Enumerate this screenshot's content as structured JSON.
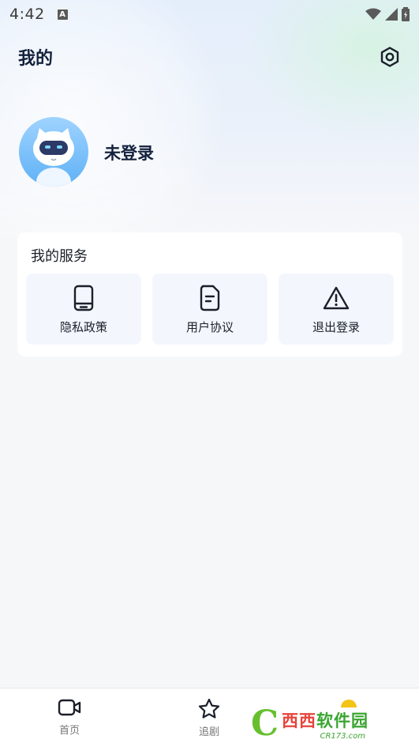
{
  "status_bar": {
    "time": "4:42",
    "notification_icon_letter": "A"
  },
  "header": {
    "title": "我的",
    "settings_icon": "hexagon-settings-icon"
  },
  "profile": {
    "avatar_icon": "robot-cat-avatar",
    "login_status": "未登录"
  },
  "services": {
    "title": "我的服务",
    "items": [
      {
        "label": "隐私政策",
        "icon": "tablet-icon"
      },
      {
        "label": "用户协议",
        "icon": "document-icon"
      },
      {
        "label": "退出登录",
        "icon": "warning-triangle-icon"
      }
    ]
  },
  "bottom_nav": {
    "items": [
      {
        "label": "首页",
        "icon": "video-icon"
      },
      {
        "label": "追剧",
        "icon": "star-icon"
      }
    ]
  },
  "watermark": {
    "brand_red": "西西",
    "brand_green": "软件园",
    "sub": "CR173.com"
  },
  "colors": {
    "title": "#14213d",
    "tile_bg": "#f3f7fd",
    "page_bg": "#f6f7f9",
    "avatar_blue": "#5fb1f6",
    "watermark_green": "#3aa531",
    "watermark_red": "#e8433a"
  }
}
